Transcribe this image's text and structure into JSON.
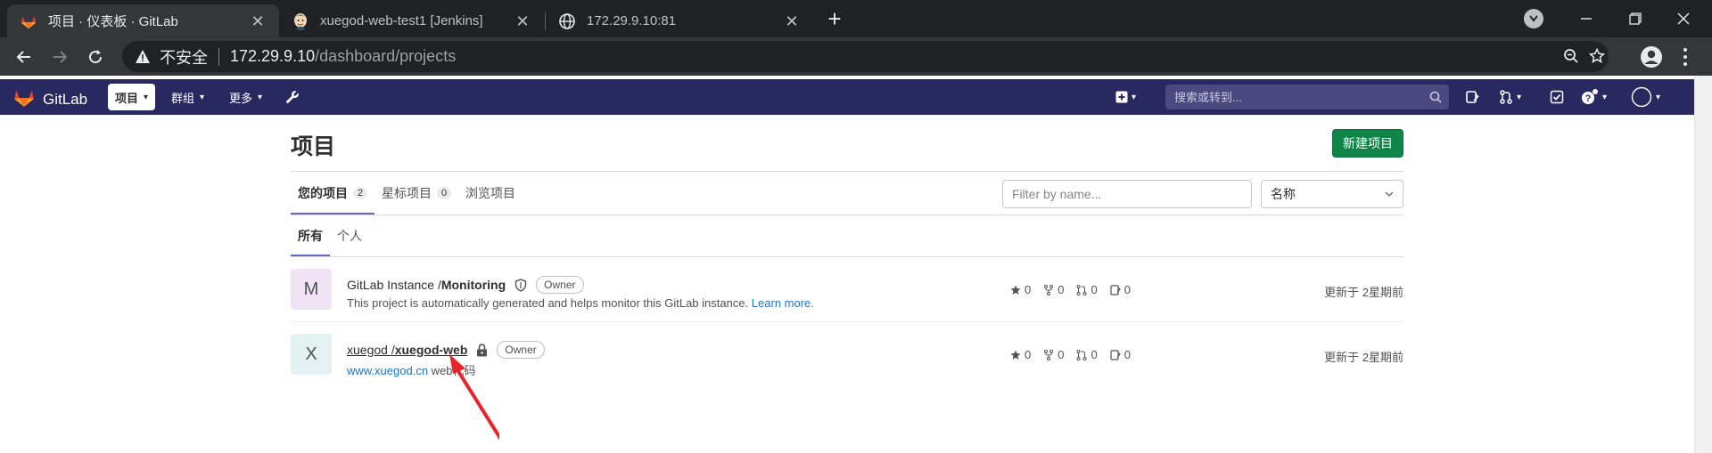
{
  "browser": {
    "tabs": [
      {
        "title": "项目 · 仪表板 · GitLab",
        "active": true,
        "favicon": "gitlab-fox-icon"
      },
      {
        "title": "xuegod-web-test1 [Jenkins]",
        "active": false,
        "favicon": "jenkins-icon"
      },
      {
        "title": "172.29.9.10:81",
        "active": false,
        "favicon": "globe-icon"
      }
    ],
    "close_glyph": "✕",
    "new_tab_glyph": "+",
    "address": {
      "security_label": "不安全",
      "host": "172.29.9.10",
      "path": "/dashboard/projects"
    }
  },
  "gitlab": {
    "logo_text": "GitLab",
    "menus": [
      {
        "label": "项目",
        "active": true
      },
      {
        "label": "群组",
        "active": false
      },
      {
        "label": "更多",
        "active": false
      }
    ],
    "search_placeholder": "搜索或转到..."
  },
  "page": {
    "title": "项目",
    "new_project_label": "新建项目",
    "tabs": [
      {
        "label": "您的项目",
        "count": "2",
        "active": true
      },
      {
        "label": "星标项目",
        "count": "0",
        "active": false
      },
      {
        "label": "浏览项目",
        "count": "",
        "active": false
      }
    ],
    "filter_placeholder": "Filter by name...",
    "sort_label": "名称",
    "subtabs": [
      {
        "label": "所有",
        "active": true
      },
      {
        "label": "个人",
        "active": false
      }
    ],
    "projects": [
      {
        "avatar_letter": "M",
        "avatar_color": "#f0e4f4",
        "namespace": "GitLab Instance / ",
        "name": "Monitoring",
        "visibility_icon": "shield-icon",
        "role": "Owner",
        "description": "This project is automatically generated and helps monitor this GitLab instance. ",
        "description_link": "Learn more.",
        "stars": "0",
        "forks": "0",
        "merge_requests": "0",
        "issues": "0",
        "updated": "更新于 2星期前"
      },
      {
        "avatar_letter": "X",
        "avatar_color": "#e2f1f1",
        "namespace": "xuegod / ",
        "name": "xuegod-web",
        "visibility_icon": "lock-icon",
        "role": "Owner",
        "description_link": "www.xuegod.cn",
        "description": " web代码",
        "stars": "0",
        "forks": "0",
        "merge_requests": "0",
        "issues": "0",
        "updated": "更新于 2星期前"
      }
    ]
  },
  "colors": {
    "gitlab_nav": "#292961",
    "new_project_button": "#108548",
    "tab_underline": "#6666c4",
    "annotation_arrow": "#e8242a"
  }
}
